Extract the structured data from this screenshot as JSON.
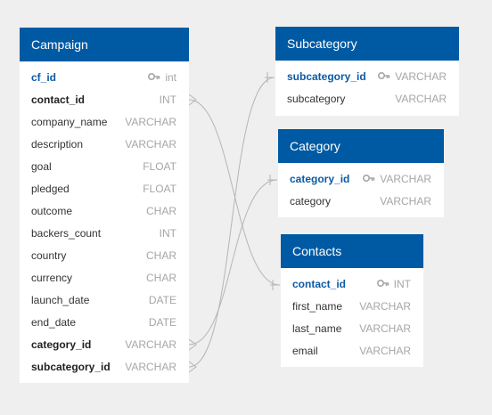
{
  "colors": {
    "header_bg": "#005aa3",
    "pk_text": "#0b5aa6",
    "type_text": "#a6a6a6",
    "line": "#b5b5b5",
    "background": "#efefef"
  },
  "tables": {
    "campaign": {
      "title": "Campaign",
      "rows": [
        {
          "name": "cf_id",
          "type": "int",
          "role": "pk"
        },
        {
          "name": "contact_id",
          "type": "INT",
          "role": "fk"
        },
        {
          "name": "company_name",
          "type": "VARCHAR",
          "role": ""
        },
        {
          "name": "description",
          "type": "VARCHAR",
          "role": ""
        },
        {
          "name": "goal",
          "type": "FLOAT",
          "role": ""
        },
        {
          "name": "pledged",
          "type": "FLOAT",
          "role": ""
        },
        {
          "name": "outcome",
          "type": "CHAR",
          "role": ""
        },
        {
          "name": "backers_count",
          "type": "INT",
          "role": ""
        },
        {
          "name": "country",
          "type": "CHAR",
          "role": ""
        },
        {
          "name": "currency",
          "type": "CHAR",
          "role": ""
        },
        {
          "name": "launch_date",
          "type": "DATE",
          "role": ""
        },
        {
          "name": "end_date",
          "type": "DATE",
          "role": ""
        },
        {
          "name": "category_id",
          "type": "VARCHAR",
          "role": "fk"
        },
        {
          "name": "subcategory_id",
          "type": "VARCHAR",
          "role": "fk"
        }
      ]
    },
    "subcategory": {
      "title": "Subcategory",
      "rows": [
        {
          "name": "subcategory_id",
          "type": "VARCHAR",
          "role": "pk"
        },
        {
          "name": "subcategory",
          "type": "VARCHAR",
          "role": ""
        }
      ]
    },
    "category": {
      "title": "Category",
      "rows": [
        {
          "name": "category_id",
          "type": "VARCHAR",
          "role": "pk"
        },
        {
          "name": "category",
          "type": "VARCHAR",
          "role": ""
        }
      ]
    },
    "contacts": {
      "title": "Contacts",
      "rows": [
        {
          "name": "contact_id",
          "type": "INT",
          "role": "pk"
        },
        {
          "name": "first_name",
          "type": "VARCHAR",
          "role": ""
        },
        {
          "name": "last_name",
          "type": "VARCHAR",
          "role": ""
        },
        {
          "name": "email",
          "type": "VARCHAR",
          "role": ""
        }
      ]
    }
  },
  "relationships": [
    {
      "from": "campaign.contact_id",
      "to": "contacts.contact_id"
    },
    {
      "from": "campaign.category_id",
      "to": "category.category_id"
    },
    {
      "from": "campaign.subcategory_id",
      "to": "subcategory.subcategory_id"
    }
  ]
}
